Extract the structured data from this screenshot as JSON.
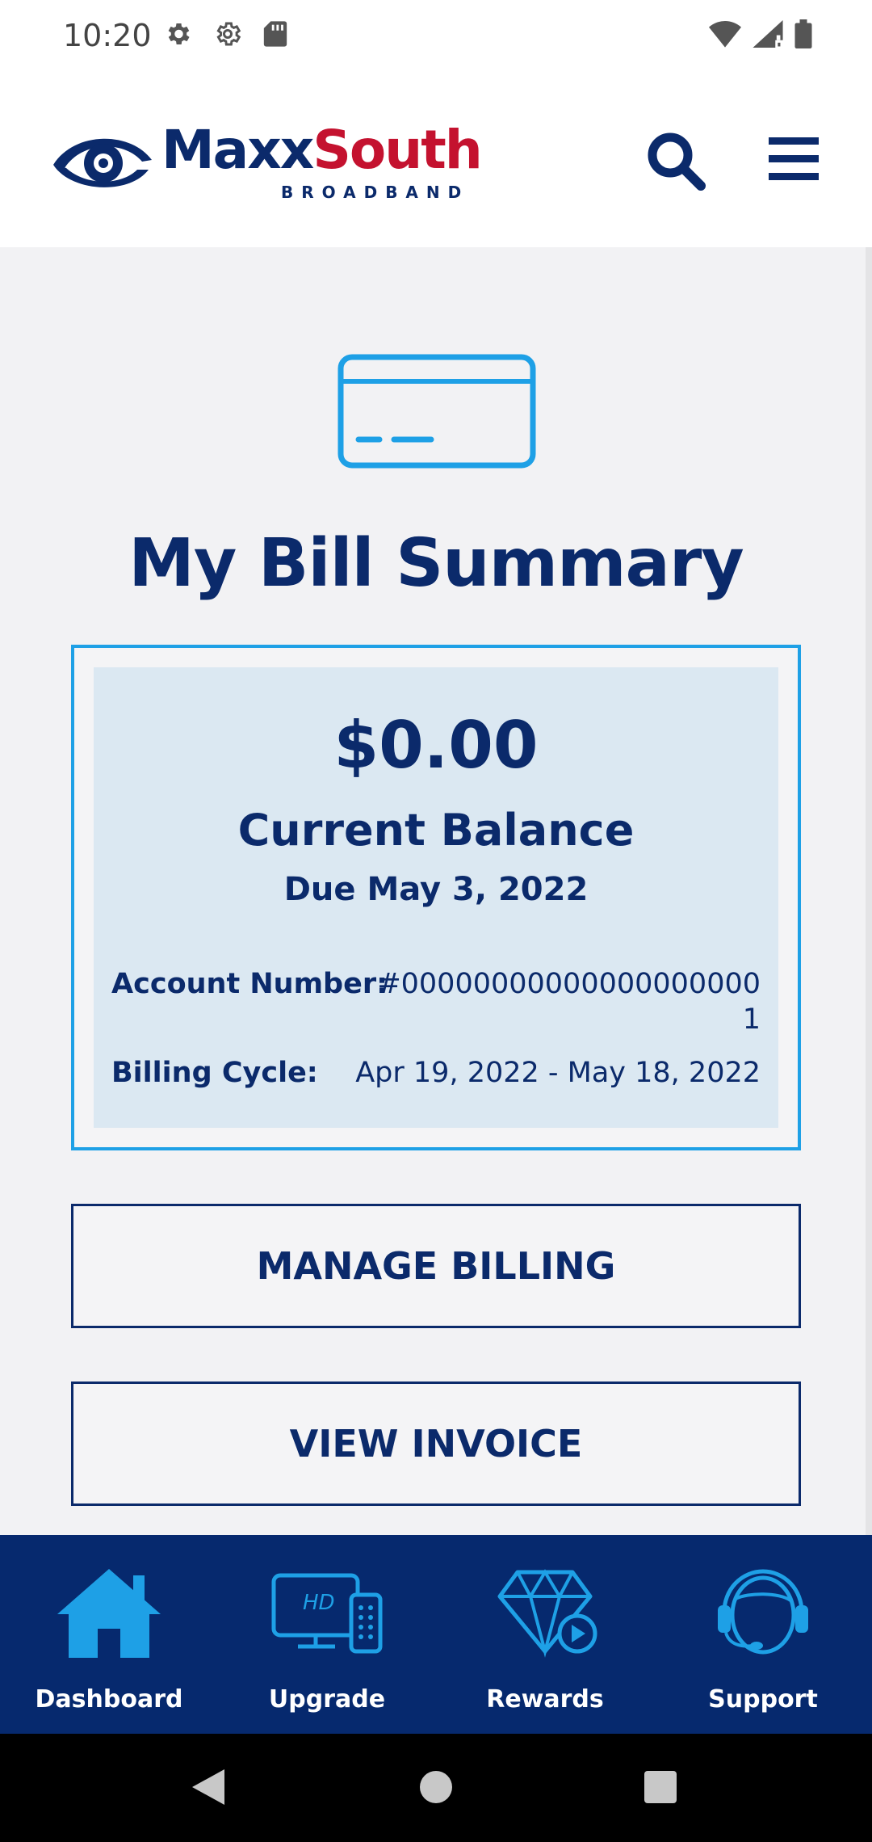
{
  "status_bar": {
    "time": "10:20",
    "left_icons": [
      "gear-icon",
      "settings-outline-icon",
      "sd-card-icon"
    ],
    "right_icons": [
      "wifi-icon",
      "signal-icon",
      "battery-icon"
    ]
  },
  "header": {
    "logo_primary": "Maxx",
    "logo_accent": "South",
    "logo_sub": "BROADBAND",
    "search_icon": "search-icon",
    "menu_icon": "hamburger-menu-icon"
  },
  "bill": {
    "icon": "credit-card-icon",
    "title": "My Bill Summary",
    "amount": "$0.00",
    "balance_label": "Current Balance",
    "due": "Due May 3, 2022",
    "account_label": "Account Number:",
    "account_value": "#000000000000000000001",
    "cycle_label": "Billing Cycle:",
    "cycle_value": "Apr 19, 2022 - May 18, 2022"
  },
  "actions": {
    "manage_billing": "MANAGE BILLING",
    "view_invoice": "VIEW INVOICE"
  },
  "bottom_nav": {
    "items": [
      {
        "label": "Dashboard",
        "icon": "home-icon"
      },
      {
        "label": "Upgrade",
        "icon": "hd-tv-remote-icon"
      },
      {
        "label": "Rewards",
        "icon": "diamond-play-icon"
      },
      {
        "label": "Support",
        "icon": "headset-agent-icon"
      }
    ]
  },
  "colors": {
    "brand_navy": "#0b2a6b",
    "brand_red": "#c4122f",
    "accent_blue": "#1ea0e6",
    "summary_bg": "#dbe8f2",
    "nav_bg": "#06296e"
  }
}
